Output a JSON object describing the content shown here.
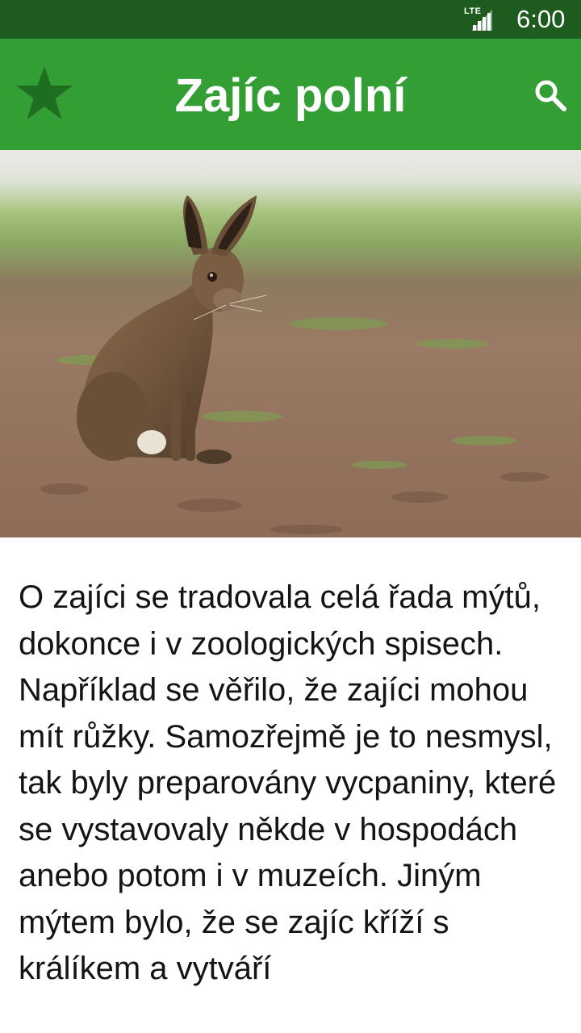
{
  "status_bar": {
    "network": "LTE",
    "time": "6:00"
  },
  "app_bar": {
    "title": "Zajíc polní",
    "favorite_icon": "star-icon",
    "search_icon": "search-icon",
    "color": "#339e34",
    "status_color": "#1e5b1f"
  },
  "hero_image": {
    "subject": "hare-in-field"
  },
  "article": {
    "text": "O zajíci se tradovala celá řada mýtů, dokonce i v zoologických spisech. Například se věřilo, že zajíci mohou mít růžky. Samozřejmě je to nesmysl, tak byly preparovány vycpaniny, které se vystavovaly někde v hospodách anebo potom i v muzeích. Jiným mýtem bylo, že se zajíc kříží s králíkem a vytváří"
  }
}
